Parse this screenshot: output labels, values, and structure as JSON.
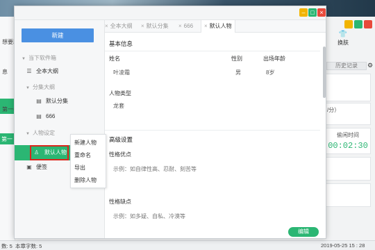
{
  "background": {
    "left_texts": [
      "想要助",
      "息",
      "第一卷",
      "第一"
    ],
    "skin_label": "换肤",
    "history_tab": "历史记录",
    "speed_text": "/分）",
    "timer_label": "偷闲时间",
    "timer_value": "00:02:30",
    "status_left": "数: 5",
    "status_chars": "本章字数: 5",
    "status_datetime": "2019-05-25 15 : 28"
  },
  "dialog": {
    "new_button": "新建",
    "sections": {
      "current": "当下软件箱",
      "outline_group": "分集大纲",
      "character_group": "人物设定"
    },
    "tree": {
      "all_outline": "全本大纲",
      "default_episode": "默认分集",
      "item_666": "666",
      "default_character": "默认人物",
      "notes": "便签"
    },
    "context_menu": [
      "新建人物",
      "重命名",
      "导出",
      "删除人物"
    ],
    "tabs": [
      "全本大纲",
      "默认分集",
      "666",
      "默认人物"
    ],
    "basic_info": {
      "heading": "基本信息",
      "name_label": "姓名",
      "gender_label": "性别",
      "age_label": "出场年龄",
      "name_value": "叶凌霜",
      "gender_value": "男",
      "age_value": "8岁",
      "type_label": "人物类型",
      "type_value": "龙套"
    },
    "advanced": {
      "heading": "高级设置",
      "strength_label": "性格优点",
      "strength_placeholder": "示例：如自律性高、忍耐、刻苦等",
      "weakness_label": "性格缺点",
      "weakness_placeholder": "示例：如多疑、自私、冷漠等"
    },
    "edit_button": "编辑"
  }
}
